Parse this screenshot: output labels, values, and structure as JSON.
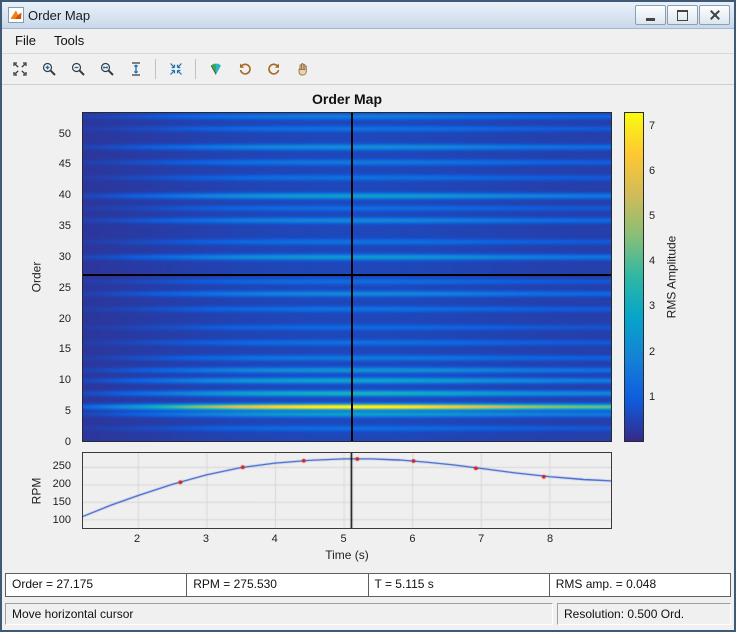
{
  "window": {
    "title": "Order Map"
  },
  "menu": {
    "items": [
      {
        "label": "File"
      },
      {
        "label": "Tools"
      }
    ]
  },
  "toolbar": {
    "buttons": [
      {
        "name": "maximize-axes"
      },
      {
        "name": "zoom-in"
      },
      {
        "name": "zoom-out"
      },
      {
        "name": "zoom-x"
      },
      {
        "name": "fit-y"
      },
      {
        "name": "restore-view"
      },
      {
        "name": "colormap"
      },
      {
        "name": "undo-view"
      },
      {
        "name": "redo-view"
      },
      {
        "name": "pan"
      }
    ]
  },
  "chart_data": [
    {
      "type": "heatmap",
      "title": "Order Map",
      "xlabel": "Time (s)",
      "ylabel": "Order",
      "x_range": [
        1.2,
        8.9
      ],
      "y_range": [
        0,
        53.5
      ],
      "y_ticks": [
        0,
        5,
        10,
        15,
        20,
        25,
        30,
        35,
        40,
        45,
        50
      ],
      "background_value": 0.18,
      "background_env_gain": 0.35,
      "streak_sigma": 0.32,
      "rpm_reference": 273,
      "order_streaks": [
        {
          "order": 2.0,
          "peak": 0.8
        },
        {
          "order": 4.3,
          "peak": 2.2
        },
        {
          "order": 5.5,
          "peak": 7.0
        },
        {
          "order": 7.7,
          "peak": 2.8
        },
        {
          "order": 9.8,
          "peak": 2.4
        },
        {
          "order": 11.5,
          "peak": 1.8
        },
        {
          "order": 13.5,
          "peak": 1.1
        },
        {
          "order": 16.0,
          "peak": 0.9
        },
        {
          "order": 18.5,
          "peak": 0.7
        },
        {
          "order": 21.5,
          "peak": 0.9
        },
        {
          "order": 24.0,
          "peak": 1.5
        },
        {
          "order": 26.0,
          "peak": 0.8
        },
        {
          "order": 30.0,
          "peak": 2.0
        },
        {
          "order": 32.5,
          "peak": 0.9
        },
        {
          "order": 36.0,
          "peak": 1.5
        },
        {
          "order": 38.0,
          "peak": 0.8
        },
        {
          "order": 40.0,
          "peak": 2.2
        },
        {
          "order": 43.0,
          "peak": 0.9
        },
        {
          "order": 45.5,
          "peak": 1.1
        },
        {
          "order": 48.0,
          "peak": 1.7
        },
        {
          "order": 51.0,
          "peak": 0.9
        },
        {
          "order": 53.0,
          "peak": 1.2
        }
      ],
      "cursor": {
        "time": 5.115,
        "order": 27.175
      },
      "colorbar": {
        "label": "RMS Amplitude",
        "ticks": [
          1,
          2,
          3,
          4,
          5,
          6,
          7
        ],
        "range": [
          0,
          7.3
        ],
        "colormap": [
          "#352a87",
          "#0f5cdd",
          "#1481d6",
          "#06a4ca",
          "#2eb7a4",
          "#87bf77",
          "#d1bb59",
          "#fec832",
          "#f9fb0e"
        ]
      }
    },
    {
      "type": "line",
      "xlabel": "Time (s)",
      "ylabel": "RPM",
      "x_range": [
        1.2,
        8.9
      ],
      "y_range": [
        75,
        290
      ],
      "x_ticks": [
        2,
        3,
        4,
        5,
        6,
        7,
        8
      ],
      "y_ticks": [
        100,
        150,
        200,
        250
      ],
      "grid_color": "#d8d8d8",
      "series": [
        {
          "name": "rpm-profile",
          "color": "#2952cc",
          "x": [
            1.2,
            1.6,
            2.0,
            2.5,
            3.0,
            3.5,
            4.0,
            4.5,
            5.0,
            5.4,
            5.8,
            6.2,
            6.6,
            7.0,
            7.5,
            8.0,
            8.5,
            8.9
          ],
          "y": [
            108,
            140,
            168,
            200,
            227,
            248,
            261,
            269,
            273,
            273,
            270,
            264,
            256,
            246,
            233,
            222,
            214,
            210
          ]
        }
      ],
      "markers": {
        "color": "#cc2222",
        "points": [
          [
            2.62,
            206
          ],
          [
            3.53,
            249
          ],
          [
            4.42,
            268
          ],
          [
            5.2,
            273
          ],
          [
            6.02,
            267
          ],
          [
            6.93,
            246
          ],
          [
            7.92,
            222
          ]
        ]
      },
      "cursor_time": 5.115
    }
  ],
  "readouts": [
    {
      "text": "Order = 27.175"
    },
    {
      "text": "RPM = 275.530"
    },
    {
      "text": "T = 5.115 s"
    },
    {
      "text": "RMS amp. = 0.048"
    }
  ],
  "statusbar": {
    "left": "Move horizontal cursor",
    "right": "Resolution: 0.500 Ord."
  }
}
